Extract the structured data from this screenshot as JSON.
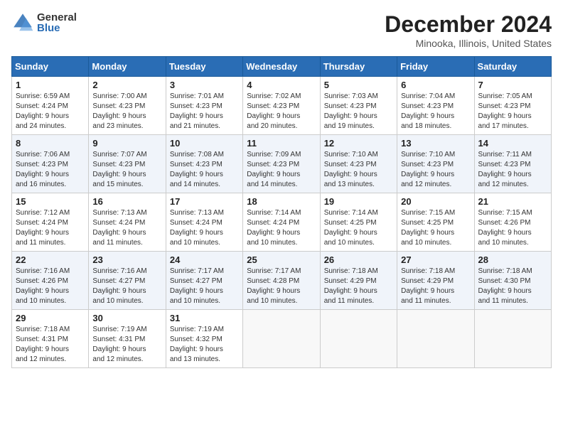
{
  "header": {
    "logo_general": "General",
    "logo_blue": "Blue",
    "month_title": "December 2024",
    "location": "Minooka, Illinois, United States"
  },
  "weekdays": [
    "Sunday",
    "Monday",
    "Tuesday",
    "Wednesday",
    "Thursday",
    "Friday",
    "Saturday"
  ],
  "weeks": [
    [
      {
        "day": "1",
        "sunrise": "6:59 AM",
        "sunset": "4:24 PM",
        "daylight": "9 hours and 24 minutes."
      },
      {
        "day": "2",
        "sunrise": "7:00 AM",
        "sunset": "4:23 PM",
        "daylight": "9 hours and 23 minutes."
      },
      {
        "day": "3",
        "sunrise": "7:01 AM",
        "sunset": "4:23 PM",
        "daylight": "9 hours and 21 minutes."
      },
      {
        "day": "4",
        "sunrise": "7:02 AM",
        "sunset": "4:23 PM",
        "daylight": "9 hours and 20 minutes."
      },
      {
        "day": "5",
        "sunrise": "7:03 AM",
        "sunset": "4:23 PM",
        "daylight": "9 hours and 19 minutes."
      },
      {
        "day": "6",
        "sunrise": "7:04 AM",
        "sunset": "4:23 PM",
        "daylight": "9 hours and 18 minutes."
      },
      {
        "day": "7",
        "sunrise": "7:05 AM",
        "sunset": "4:23 PM",
        "daylight": "9 hours and 17 minutes."
      }
    ],
    [
      {
        "day": "8",
        "sunrise": "7:06 AM",
        "sunset": "4:23 PM",
        "daylight": "9 hours and 16 minutes."
      },
      {
        "day": "9",
        "sunrise": "7:07 AM",
        "sunset": "4:23 PM",
        "daylight": "9 hours and 15 minutes."
      },
      {
        "day": "10",
        "sunrise": "7:08 AM",
        "sunset": "4:23 PM",
        "daylight": "9 hours and 14 minutes."
      },
      {
        "day": "11",
        "sunrise": "7:09 AM",
        "sunset": "4:23 PM",
        "daylight": "9 hours and 14 minutes."
      },
      {
        "day": "12",
        "sunrise": "7:10 AM",
        "sunset": "4:23 PM",
        "daylight": "9 hours and 13 minutes."
      },
      {
        "day": "13",
        "sunrise": "7:10 AM",
        "sunset": "4:23 PM",
        "daylight": "9 hours and 12 minutes."
      },
      {
        "day": "14",
        "sunrise": "7:11 AM",
        "sunset": "4:23 PM",
        "daylight": "9 hours and 12 minutes."
      }
    ],
    [
      {
        "day": "15",
        "sunrise": "7:12 AM",
        "sunset": "4:24 PM",
        "daylight": "9 hours and 11 minutes."
      },
      {
        "day": "16",
        "sunrise": "7:13 AM",
        "sunset": "4:24 PM",
        "daylight": "9 hours and 11 minutes."
      },
      {
        "day": "17",
        "sunrise": "7:13 AM",
        "sunset": "4:24 PM",
        "daylight": "9 hours and 10 minutes."
      },
      {
        "day": "18",
        "sunrise": "7:14 AM",
        "sunset": "4:24 PM",
        "daylight": "9 hours and 10 minutes."
      },
      {
        "day": "19",
        "sunrise": "7:14 AM",
        "sunset": "4:25 PM",
        "daylight": "9 hours and 10 minutes."
      },
      {
        "day": "20",
        "sunrise": "7:15 AM",
        "sunset": "4:25 PM",
        "daylight": "9 hours and 10 minutes."
      },
      {
        "day": "21",
        "sunrise": "7:15 AM",
        "sunset": "4:26 PM",
        "daylight": "9 hours and 10 minutes."
      }
    ],
    [
      {
        "day": "22",
        "sunrise": "7:16 AM",
        "sunset": "4:26 PM",
        "daylight": "9 hours and 10 minutes."
      },
      {
        "day": "23",
        "sunrise": "7:16 AM",
        "sunset": "4:27 PM",
        "daylight": "9 hours and 10 minutes."
      },
      {
        "day": "24",
        "sunrise": "7:17 AM",
        "sunset": "4:27 PM",
        "daylight": "9 hours and 10 minutes."
      },
      {
        "day": "25",
        "sunrise": "7:17 AM",
        "sunset": "4:28 PM",
        "daylight": "9 hours and 10 minutes."
      },
      {
        "day": "26",
        "sunrise": "7:18 AM",
        "sunset": "4:29 PM",
        "daylight": "9 hours and 11 minutes."
      },
      {
        "day": "27",
        "sunrise": "7:18 AM",
        "sunset": "4:29 PM",
        "daylight": "9 hours and 11 minutes."
      },
      {
        "day": "28",
        "sunrise": "7:18 AM",
        "sunset": "4:30 PM",
        "daylight": "9 hours and 11 minutes."
      }
    ],
    [
      {
        "day": "29",
        "sunrise": "7:18 AM",
        "sunset": "4:31 PM",
        "daylight": "9 hours and 12 minutes."
      },
      {
        "day": "30",
        "sunrise": "7:19 AM",
        "sunset": "4:31 PM",
        "daylight": "9 hours and 12 minutes."
      },
      {
        "day": "31",
        "sunrise": "7:19 AM",
        "sunset": "4:32 PM",
        "daylight": "9 hours and 13 minutes."
      },
      null,
      null,
      null,
      null
    ]
  ]
}
